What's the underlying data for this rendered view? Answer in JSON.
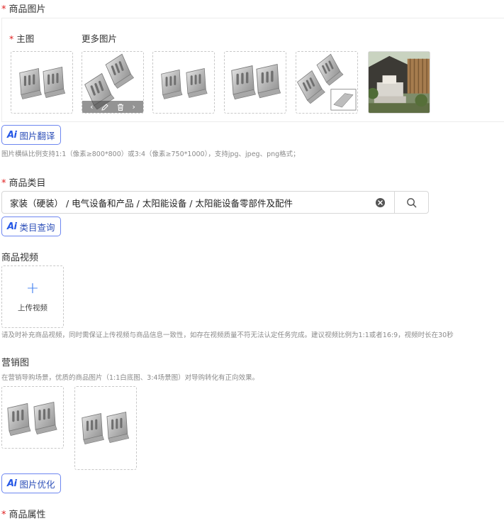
{
  "images_section": {
    "required_mark": "*",
    "title": "商品图片",
    "main_label_required": "*",
    "main_label": "主图",
    "more_label": "更多图片",
    "thumb_toolbar_icons": [
      "chevron-left-icon",
      "edit-icon",
      "trash-icon",
      "chevron-right-icon"
    ],
    "ai_badge": "Ai",
    "ai_button": "图片翻译",
    "hint": "图片横纵比例支持1:1（像素≥800*800）或3:4（像素≥750*1000），支持jpg、jpeg、png格式；"
  },
  "category_section": {
    "required_mark": "*",
    "title": "商品类目",
    "value": "家装（硬装） / 电气设备和产品 / 太阳能设备 / 太阳能设备零部件及配件",
    "clear_icon": "clear-circle-icon",
    "search_icon": "search-icon",
    "ai_badge": "Ai",
    "ai_button": "类目查询"
  },
  "video_section": {
    "title": "商品视频",
    "upload_label": "上传视频",
    "plus_glyph": "+",
    "hint": "请及时补充商品视频，同时需保证上传视频与商品信息一致性，如存在视频质量不符无法认定任务完成。建议视频比例为1:1或者16:9，视频时长在30秒"
  },
  "marketing_section": {
    "title": "营销图",
    "hint": "在营销导购场景，优质的商品图片（1:1白底图、3:4场景图）对导购转化有正向效果。",
    "ai_badge": "Ai",
    "ai_button": "图片优化"
  },
  "attributes_section": {
    "required_mark": "*",
    "title": "商品属性"
  },
  "colors": {
    "required": "#e02020",
    "ai_border": "#6d86f0",
    "ai_text": "#2d4fb8",
    "plus": "#3b7cf0"
  }
}
